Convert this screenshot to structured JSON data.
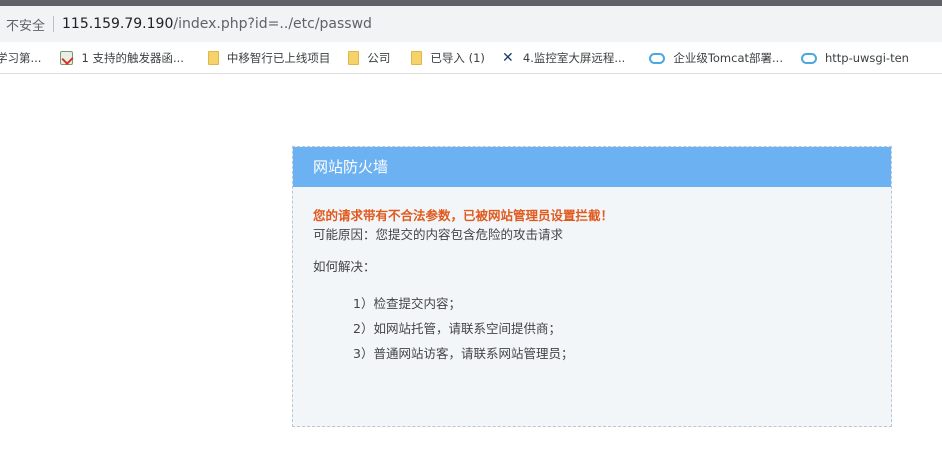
{
  "address": {
    "security_label": "不安全",
    "url_host": "115.159.79.190",
    "url_path": "/index.php?id=../etc/passwd"
  },
  "bookmarks": [
    {
      "label": "学习第...",
      "icon": "none"
    },
    {
      "label": "1 支持的触发器函...",
      "icon": "page-icon"
    },
    {
      "label": "中移智行已上线项目",
      "icon": "folder-icon"
    },
    {
      "label": "公司",
      "icon": "folder-icon"
    },
    {
      "label": "已导入 (1)",
      "icon": "folder-icon"
    },
    {
      "label": "4.监控室大屏远程...",
      "icon": "x-icon"
    },
    {
      "label": "企业级Tomcat部署...",
      "icon": "cloud-icon"
    },
    {
      "label": "http-uwsgi-ten",
      "icon": "cloud-icon"
    }
  ],
  "firewall": {
    "title": "网站防火墙",
    "warning": "您的请求带有不合法参数，已被网站管理员设置拦截！",
    "reason": "可能原因：您提交的内容包含危险的攻击请求",
    "how_to": "如何解决：",
    "steps": [
      "1）检查提交内容；",
      "2）如网站托管，请联系空间提供商；",
      "3）普通网站访客，请联系网站管理员；"
    ]
  },
  "colors": {
    "header_bg": "#6cb2f2",
    "warning_text": "#e05a1e",
    "box_bg": "#f2f6f9"
  }
}
